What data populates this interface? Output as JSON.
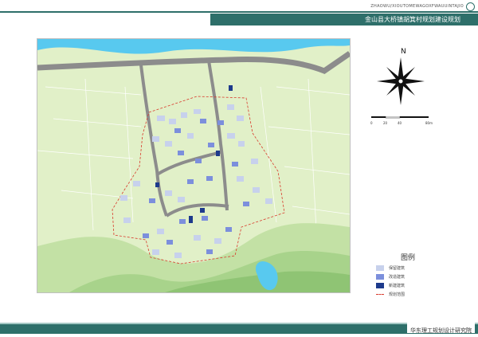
{
  "header": {
    "caption": "ZHAOWU/XIOUTOMEWAGOXFWAUUINTAJIO",
    "title": "金山县大桥镇胡箕村规划建设规划"
  },
  "map": {
    "north_label": "N",
    "scale_labels": [
      "0",
      "20",
      "40",
      "80m"
    ]
  },
  "legend": {
    "title": "图例",
    "items": [
      {
        "label": "保留建筑",
        "color": "#c7d1ec"
      },
      {
        "label": "改造建筑",
        "color": "#7c8fdc"
      },
      {
        "label": "新建建筑",
        "color": "#1d3a8c"
      },
      {
        "label": "规划范围",
        "color": "#d83a2c",
        "style": "dashed"
      }
    ]
  },
  "footer": {
    "text": "华东理工规划设计研究院"
  },
  "colors": {
    "accent": "#2e6f6a",
    "green_light": "#e1f0c8",
    "water": "#58c9ef",
    "road": "#8c8c8c"
  }
}
